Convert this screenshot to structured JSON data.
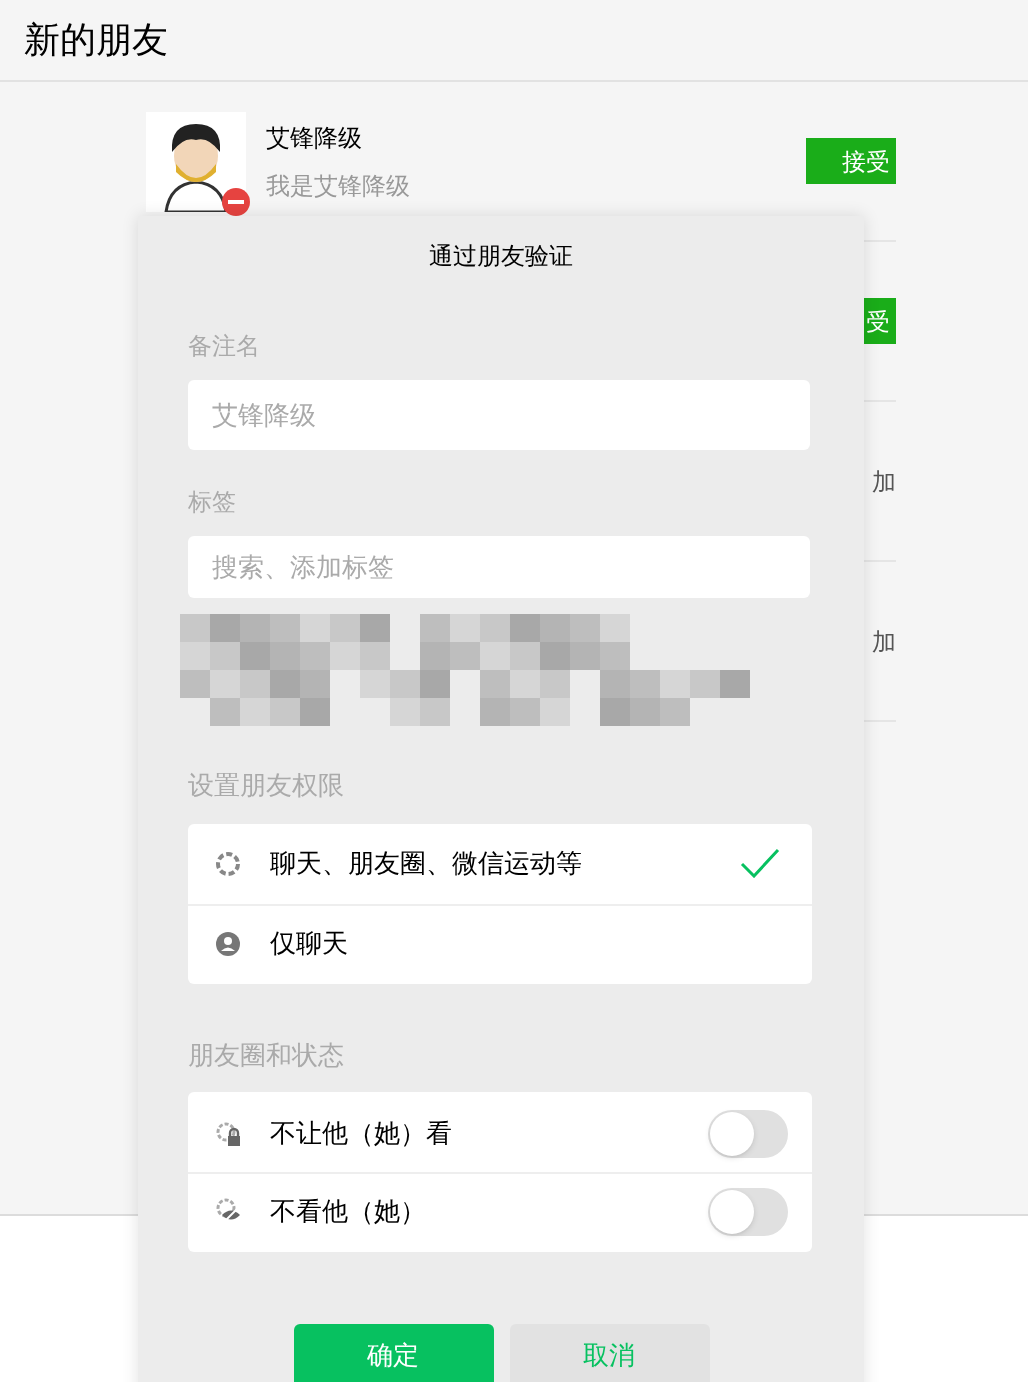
{
  "header": {
    "title": "新的朋友"
  },
  "requests": [
    {
      "kind": "button",
      "name": "艾锋降级",
      "message": "我是艾锋降级",
      "action": "接受"
    },
    {
      "kind": "button",
      "action": "受"
    },
    {
      "kind": "text",
      "action": "加"
    },
    {
      "kind": "text",
      "action": "加"
    }
  ],
  "dialog": {
    "title": "通过朋友验证",
    "remark": {
      "label": "备注名",
      "placeholder": "艾锋降级"
    },
    "tags": {
      "label": "标签",
      "placeholder": "搜索、添加标签"
    },
    "permissions": {
      "label": "设置朋友权限",
      "options": [
        {
          "kind": "moments",
          "label": "聊天、朋友圈、微信运动等",
          "selected": true
        },
        {
          "kind": "chat",
          "label": "仅聊天",
          "selected": false
        }
      ]
    },
    "moments": {
      "label": "朋友圈和状态",
      "toggles": [
        {
          "kind": "lock",
          "label": "不让他（她）看",
          "on": false
        },
        {
          "kind": "eye",
          "label": "不看他（她）",
          "on": false
        }
      ]
    },
    "confirm": "确定",
    "cancel": "取消"
  }
}
